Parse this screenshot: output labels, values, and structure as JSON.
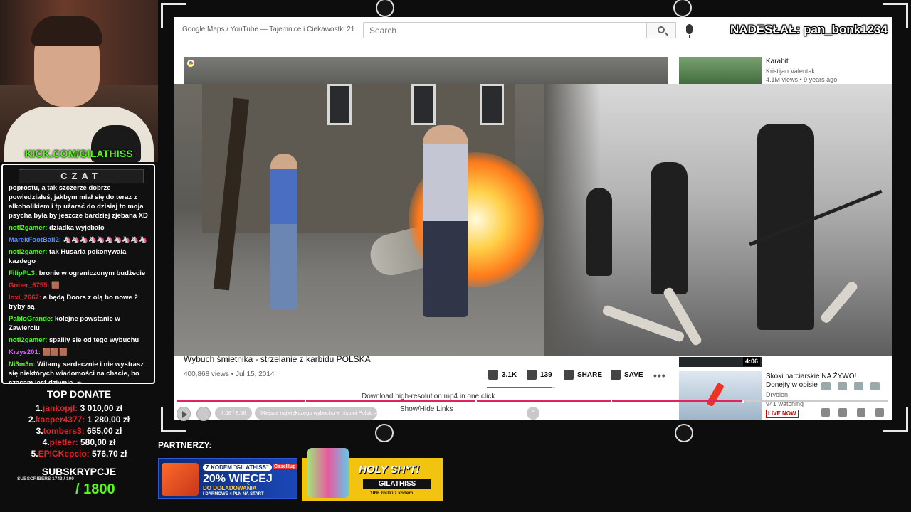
{
  "streamer": {
    "kick_url": "KICK.COM/GILATHISS"
  },
  "chat": {
    "title": "CZAT",
    "messages": [
      {
        "user": "",
        "color": "#ffffff",
        "text": "poprostu, a tak szczerze dobrze powiedziałeś, jakbym miał się do teraz z alkoholikiem i tp użarać do dzisiaj to moja psycha była by jeszcze bardziej zjebana XD"
      },
      {
        "user": "notl2gamer:",
        "color": "#53fc18",
        "text": "dziadka wyjebało"
      },
      {
        "user": "MarekFootBall2:",
        "color": "#5c8cff",
        "text": "🦄🦄🦄🦄🦄🦄🦄🦄🦄🦄"
      },
      {
        "user": "notl2gamer:",
        "color": "#53fc18",
        "text": "tak Husaria pokonywała kazdego"
      },
      {
        "user": "FilipPL3:",
        "color": "#53fc18",
        "text": "bronie w ograniczonym budżecie"
      },
      {
        "user": "Gober_6755:",
        "color": "#e3242b",
        "text": "🟫"
      },
      {
        "user": "loxi_2667:",
        "color": "#e3242b",
        "text": "a będą Doors z olą bo nowe 2 tryby są"
      },
      {
        "user": "PabloGrande:",
        "color": "#53fc18",
        "text": "kolejne powstanie w Zawierciu"
      },
      {
        "user": "notl2gamer:",
        "color": "#53fc18",
        "text": "spallly sie od tego wybuchu"
      },
      {
        "user": "Krzys201:",
        "color": "#d65cff",
        "text": "🟫🟫🟫"
      },
      {
        "user": "Ni3m3n:",
        "color": "#53fc18",
        "text": "Witamy serdecznie i nie wystrasz się niektórych wiadomości na chacie, bo czasam jest dziwnie 🚗"
      }
    ]
  },
  "donations": {
    "title": "TOP DONATE",
    "rows": [
      {
        "rank": "1.",
        "name": "jankopjl:",
        "amount": "3 010,00 zł"
      },
      {
        "rank": "2.",
        "name": "kacper4377:",
        "amount": "1 280,00 zł"
      },
      {
        "rank": "3.",
        "name": "tombers3:",
        "amount": "655,00 zł"
      },
      {
        "rank": "4.",
        "name": "pletler:",
        "amount": "580,00 zł"
      },
      {
        "rank": "5.",
        "name": "EPICKepcio:",
        "amount": "576,70 zł"
      }
    ]
  },
  "subs": {
    "title": "SUBSKRYPCJE",
    "small": "SUBSCRIBERS 1743 / 100",
    "goal": "/ 1800"
  },
  "youtube": {
    "tab_title": "Google Maps / YouTube — Tajemnice i Ciekawostki 21",
    "search_placeholder": "Search",
    "nadeslal": "NADESŁAŁ: pan_bonk1234",
    "side_video": {
      "title": "Karabit",
      "channel": "Kristijan Valentak",
      "meta": "4.1M views • 9 years ago"
    },
    "video_title": "Wybuch śmietnika - strzelanie z karbidu POLSKA",
    "views": "400,868 views • Jul 15, 2014",
    "likes": "3.1K",
    "dislikes": "139",
    "share": "SHARE",
    "save": "SAVE",
    "more": "•••",
    "like_ratio": 0.96,
    "side_video2": {
      "duration": "4:06",
      "title": "Skoki narciarskie NA ŻYWO! Donejty w opisie",
      "channel": "Drybion",
      "watching": "941 watching",
      "live": "LIVE NOW"
    }
  },
  "controls": {
    "download_text": "Download high-resolution mp4 in one click",
    "time": "7:06 / 8:56",
    "chapter": "Miejsce największego wybuchu w historii Polski >",
    "show_hide": "Show/Hide Links",
    "up_arrow": "⌃",
    "progress": 0.795
  },
  "partners": {
    "title": "PARTNERZY:",
    "promo1": {
      "code": "Z KODEM \"GILATHISS\"",
      "brand": "CaseHug",
      "big": "20% WIĘCEJ",
      "line2": "DO DOŁADOWANIA",
      "line3": "I DARMOWE 4 PLN NA START"
    },
    "promo2": {
      "headline": "HOLY SH*T!",
      "code": "GILATHISS",
      "discount": "10% zniżki z kodem"
    }
  }
}
